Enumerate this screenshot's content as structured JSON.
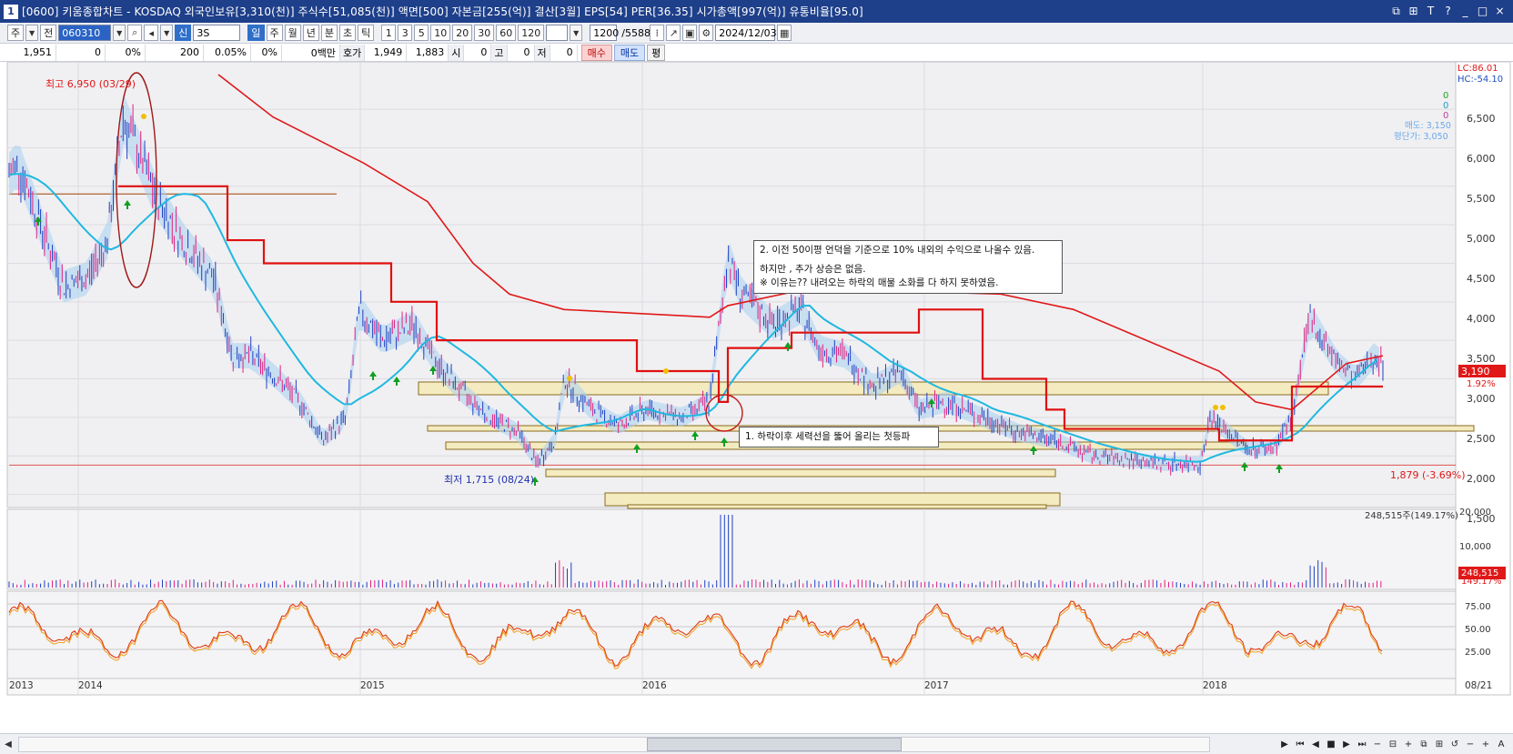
{
  "window": {
    "icon_label": "1",
    "title": "[0600] 키움종합차트 - KOSDAQ 외국인보유[3,310(천)] 주식수[51,085(천)] 액면[500] 자본금[255(억)] 결산[3월] EPS[54] PER[36.35] 시가총액[997(억)] 유통비율[95.0]",
    "controls": [
      "⧉",
      "⊞",
      "T",
      "?",
      "_",
      "□",
      "×"
    ]
  },
  "toolbar": {
    "period_select": "주",
    "compare_select": "전",
    "stock_code": "060310",
    "market_badge": "신",
    "stock_name": "3S",
    "intervals": [
      "일",
      "주",
      "월",
      "년",
      "분",
      "초",
      "틱"
    ],
    "minute_steps": [
      "1",
      "3",
      "5",
      "10",
      "20",
      "30",
      "60",
      "120"
    ],
    "data_count": "1200",
    "data_total": "/5588",
    "date": "2024/12/03"
  },
  "info": {
    "price": "1,951",
    "change": "0",
    "change_rate": "0%",
    "volume": "200",
    "volume_rate": "0.05%",
    "turnover": "0%",
    "amount": "0백만",
    "ask_label": "호가",
    "ask": "1,949",
    "bid": "1,883",
    "open_label": "시",
    "open": "0",
    "high_label": "고",
    "high": "0",
    "low_label": "저",
    "low": "0",
    "buy_label": "매수",
    "sell_label": "매도",
    "flat_label": "평"
  },
  "chart": {
    "y_axis_labels": [
      "6,500",
      "6,000",
      "5,500",
      "5,000",
      "4,500",
      "4,000",
      "3,500",
      "3,000",
      "2,500",
      "2,000",
      "1,500"
    ],
    "x_axis_labels": [
      "2013",
      "2014",
      "2015",
      "2016",
      "2017",
      "2018",
      "08/21"
    ],
    "high_marker": "최고 6,950 (03/29)",
    "low_marker": "최저 1,715 (08/24)",
    "lc_label": "LC:86.01",
    "hc_label": "HC:-54.10",
    "legend_values": [
      "0",
      "0",
      "0"
    ],
    "legend_note_1": "매도: 3,150",
    "legend_note_2": "평단가: 3,050",
    "current_price": "3,190",
    "current_change": "1.92%",
    "support_label": "1,879 (-3.69%)",
    "volume_peak_label": "248,515주(149.17%)",
    "volume_axis_labels": [
      "20,000",
      "10,000"
    ],
    "volume_current": "248,515",
    "volume_current_rate": "149.17%",
    "stoch_axis_labels": [
      "75.00",
      "50.00",
      "25.00"
    ],
    "annotation_1": "1. 하락이후 세력선을 뚫어 올리는 첫등파",
    "annotation_2_line1": "2. 이전 50이평 언덕을 기준으로 10% 내외의 수익으로 나올수 있음.",
    "annotation_2_line2": "하지만 , 추가 상승은 없음.",
    "annotation_2_line3": "※ 이유는?? 내려오는 하락의 매물 소화를 다 하지 못하였음."
  },
  "colors": {
    "title_bg": "#1e3f8a",
    "candle": "#c040a0",
    "ma_cyan": "#20b8e0",
    "ma_red": "#e01818",
    "band_fill": "#a8cff0",
    "zone_fill": "#f4ecc0"
  }
}
